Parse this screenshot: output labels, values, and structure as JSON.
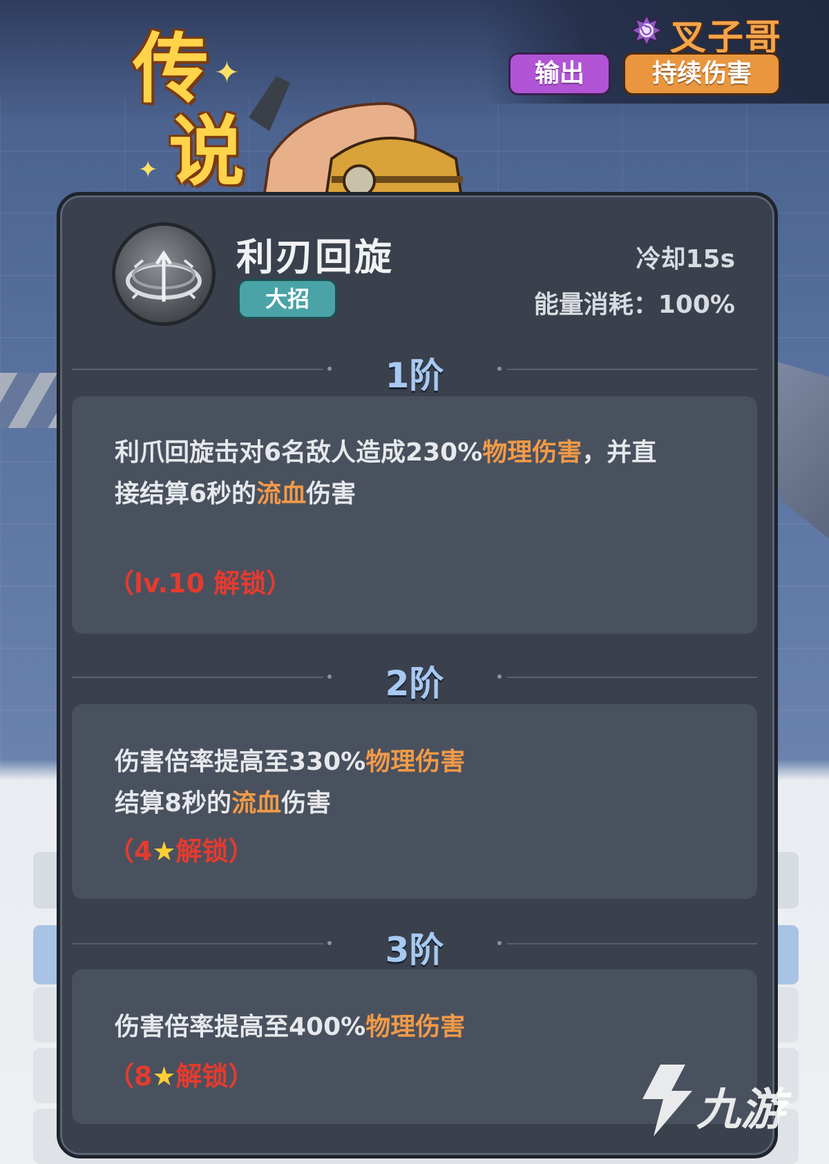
{
  "header": {
    "hero_name": "叉子哥",
    "hero_emblem_icon": "swirl-emblem-icon",
    "tags": [
      "输出",
      "持续伤害"
    ],
    "rarity": [
      "传",
      "说"
    ]
  },
  "skill": {
    "icon": "spinning-claw-skill-icon",
    "name": "利刃回旋",
    "type": "大招",
    "cooldown": "冷却15s",
    "energy_cost": "能量消耗：100%"
  },
  "tiers": [
    {
      "title": "1阶",
      "lines": [
        [
          {
            "text": "利爪回旋击对6名敌人造成230%",
            "kw": false
          },
          {
            "text": "物理伤害",
            "kw": true
          },
          {
            "text": "，并直",
            "kw": false
          }
        ],
        [
          {
            "text": "接结算6秒的",
            "kw": false
          },
          {
            "text": "流血",
            "kw": true
          },
          {
            "text": "伤害",
            "kw": false
          }
        ]
      ],
      "unlock": "（lv.10 解锁）"
    },
    {
      "title": "2阶",
      "lines": [
        [
          {
            "text": "伤害倍率提高至330%",
            "kw": false
          },
          {
            "text": "物理伤害",
            "kw": true
          }
        ],
        [
          {
            "text": "结算8秒的",
            "kw": false
          },
          {
            "text": "流血",
            "kw": true
          },
          {
            "text": "伤害",
            "kw": false
          }
        ]
      ],
      "unlock_prefix": "（4",
      "unlock_star": "★",
      "unlock_suffix": "解锁）"
    },
    {
      "title": "3阶",
      "lines": [
        [
          {
            "text": "伤害倍率提高至400%",
            "kw": false
          },
          {
            "text": "物理伤害",
            "kw": true
          }
        ]
      ],
      "unlock_prefix": "（8",
      "unlock_star": "★",
      "unlock_suffix": "解锁）"
    }
  ],
  "watermark": {
    "logo_icon": "jiuyou-logo-icon",
    "text": "九游"
  },
  "colors": {
    "keyword": "#f29a48",
    "unlock": "#e43b2f",
    "tier_title": "#a8c9f2",
    "tag_output": "#b154d6",
    "tag_dot": "#e9963e",
    "skill_type": "#4aa3a6"
  }
}
